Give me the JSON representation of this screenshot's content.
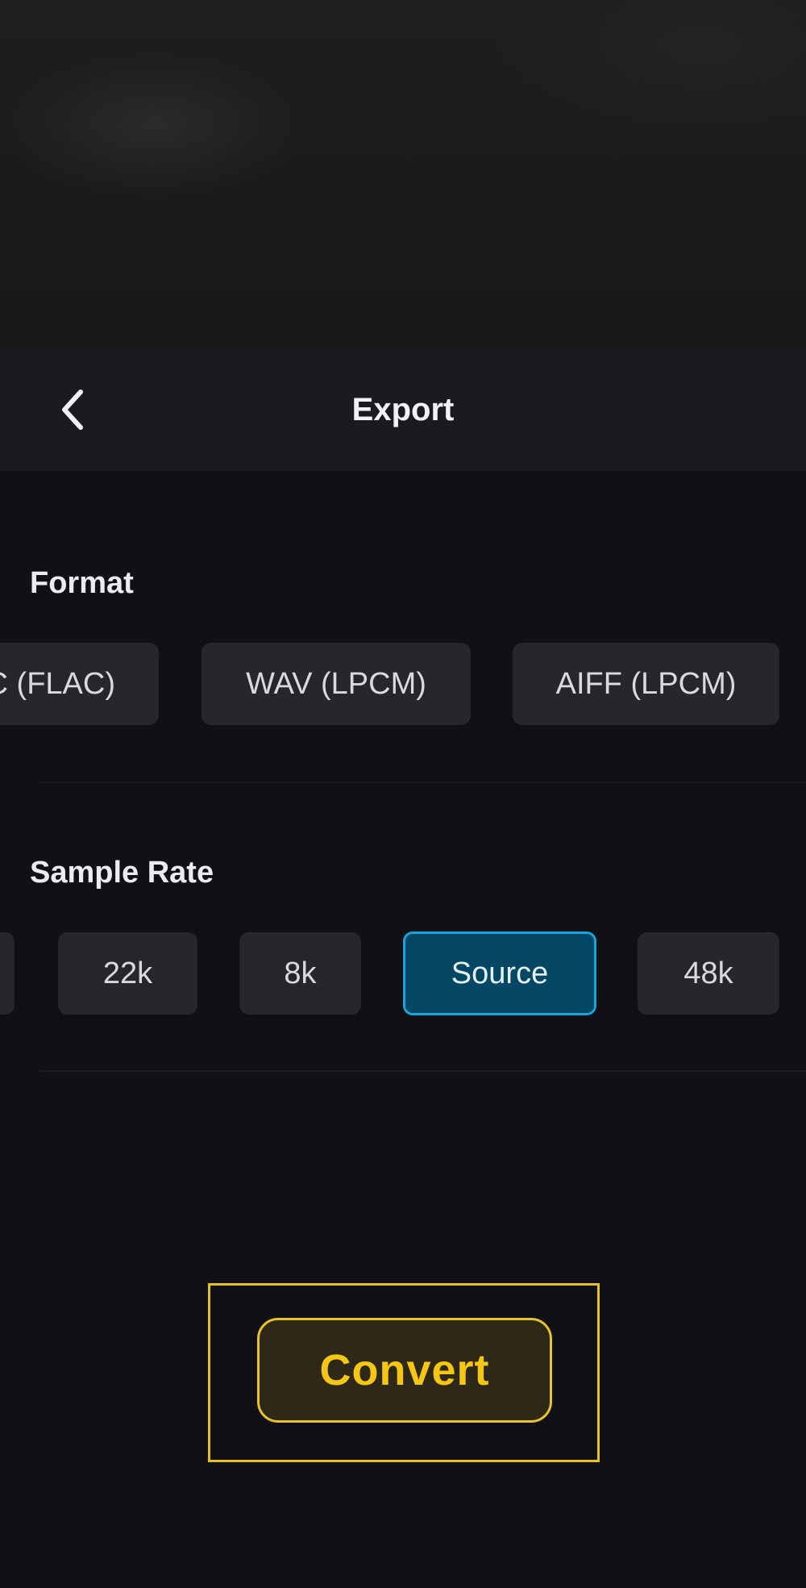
{
  "header": {
    "title": "Export",
    "back_icon": "chevron-left-icon"
  },
  "format": {
    "label": "Format",
    "options": [
      {
        "label": "FLAC (FLAC)",
        "visible_text": "C (FLAC)",
        "selected": false
      },
      {
        "label": "WAV (LPCM)",
        "selected": false
      },
      {
        "label": "AIFF (LPCM)",
        "selected": false
      }
    ]
  },
  "sample_rate": {
    "label": "Sample Rate",
    "options": [
      {
        "label": "",
        "selected": false
      },
      {
        "label": "22k",
        "selected": false
      },
      {
        "label": "8k",
        "selected": false
      },
      {
        "label": "Source",
        "selected": true
      },
      {
        "label": "48k",
        "selected": false
      }
    ]
  },
  "actions": {
    "convert_label": "Convert"
  },
  "colors": {
    "background": "#111115",
    "header": "#1a1a20",
    "chip": "#26262c",
    "selected_chip": "#034764",
    "selected_border": "#1aa3d8",
    "accent": "#f5c714"
  }
}
